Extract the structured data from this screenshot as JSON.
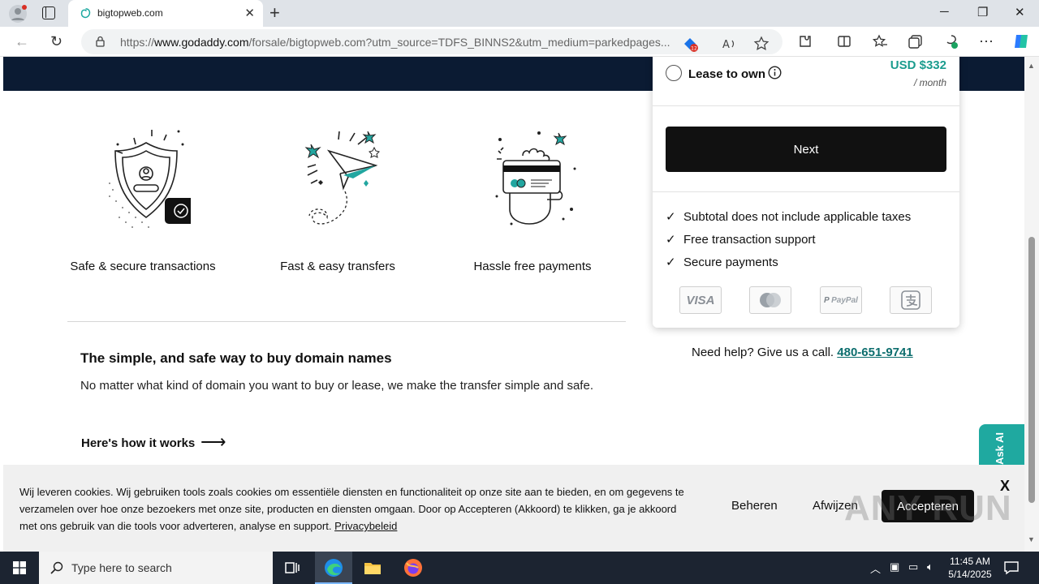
{
  "browser": {
    "tab_title": "bigtopweb.com",
    "url_prefix": "https://",
    "url_host": "www.godaddy.com",
    "url_rest": "/forsale/bigtopweb.com?utm_source=TDFS_BINNS2&utm_medium=parkedpages...",
    "badge_count": "12"
  },
  "features": [
    {
      "label": "Safe & secure transactions",
      "icon": "shield-user-icon"
    },
    {
      "label": "Fast & easy transfers",
      "icon": "paper-plane-icon"
    },
    {
      "label": "Hassle free payments",
      "icon": "card-hand-icon"
    }
  ],
  "content": {
    "heading": "The simple, and safe way to buy domain names",
    "description": "No matter what kind of domain you want to buy or lease, we make the transfer simple and safe.",
    "how_link": "Here's how it works"
  },
  "panel": {
    "lease_label": "Lease to own",
    "price": "USD $332",
    "per_month": "/ month",
    "next_label": "Next",
    "checks": [
      "Subtotal does not include applicable taxes",
      "Free transaction support",
      "Secure payments"
    ],
    "payment_methods": [
      "VISA",
      "mastercard",
      "PayPal",
      "alipay"
    ],
    "help_text": "Need help? Give us a call.",
    "help_phone": "480-651-9741"
  },
  "ask_ai": "Ask AI",
  "cookie": {
    "text": "Wij leveren cookies. Wij gebruiken tools zoals cookies om essentiële diensten en functionaliteit op onze site aan te bieden, en om gegevens te verzamelen over hoe onze bezoekers met onze site, producten en diensten omgaan. Door op Accepteren (Akkoord) te klikken, ga je akkoord met ons gebruik van die tools voor adverteren, analyse en support.",
    "privacy_link": "Privacybeleid",
    "manage_label": "Beheren",
    "reject_label": "Afwijzen",
    "accept_label": "Accepteren",
    "close_label": "X"
  },
  "watermark": "ANY RUN",
  "taskbar": {
    "search_placeholder": "Type here to search",
    "time": "11:45 AM",
    "date": "5/14/2025"
  },
  "colors": {
    "accent_teal": "#1b9c8e",
    "dark_band": "#0b1b33",
    "taskbar": "#1c2431"
  }
}
